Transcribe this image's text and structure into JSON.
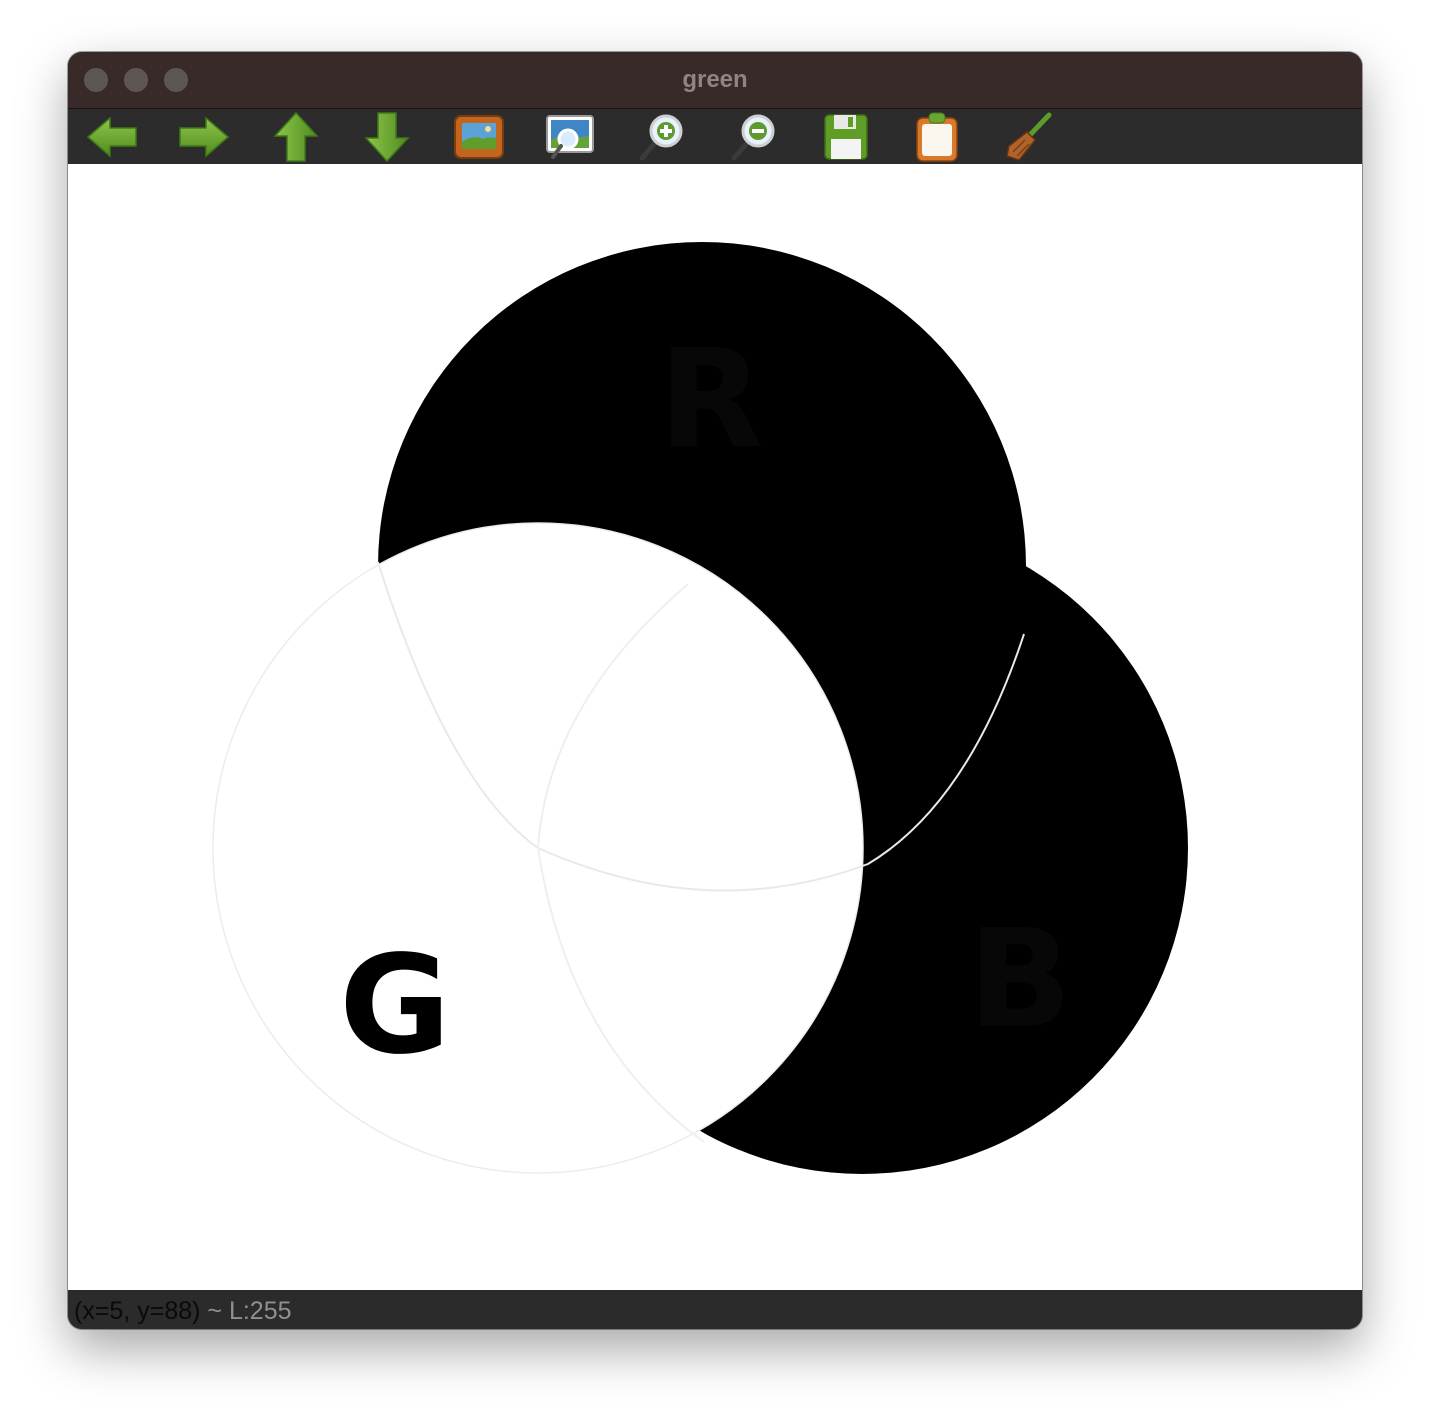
{
  "window": {
    "title": "green"
  },
  "toolbar": {
    "items": [
      {
        "name": "pan-left",
        "icon": "arrow-left-icon"
      },
      {
        "name": "pan-right",
        "icon": "arrow-right-icon"
      },
      {
        "name": "pan-up",
        "icon": "arrow-up-icon"
      },
      {
        "name": "pan-down",
        "icon": "arrow-down-icon"
      },
      {
        "name": "zoom-fit",
        "icon": "image-frame-icon"
      },
      {
        "name": "zoom-original",
        "icon": "image-magnifier-icon"
      },
      {
        "name": "zoom-in",
        "icon": "zoom-in-icon"
      },
      {
        "name": "zoom-out",
        "icon": "zoom-out-icon"
      },
      {
        "name": "save",
        "icon": "floppy-disk-icon"
      },
      {
        "name": "copy-to-clipboard",
        "icon": "clipboard-icon"
      },
      {
        "name": "properties",
        "icon": "broom-icon"
      }
    ],
    "colors": {
      "arrow": "#6aa531",
      "arrow_dark": "#3f7a17"
    }
  },
  "canvas": {
    "labels": {
      "r": "R",
      "g": "G",
      "b": "B"
    },
    "colors": {
      "background": "#ffffff",
      "channel_on": "#ffffff",
      "channel_off": "#000000"
    }
  },
  "status": {
    "coords": "(x=5, y=88)",
    "value": " ~ L:255"
  }
}
